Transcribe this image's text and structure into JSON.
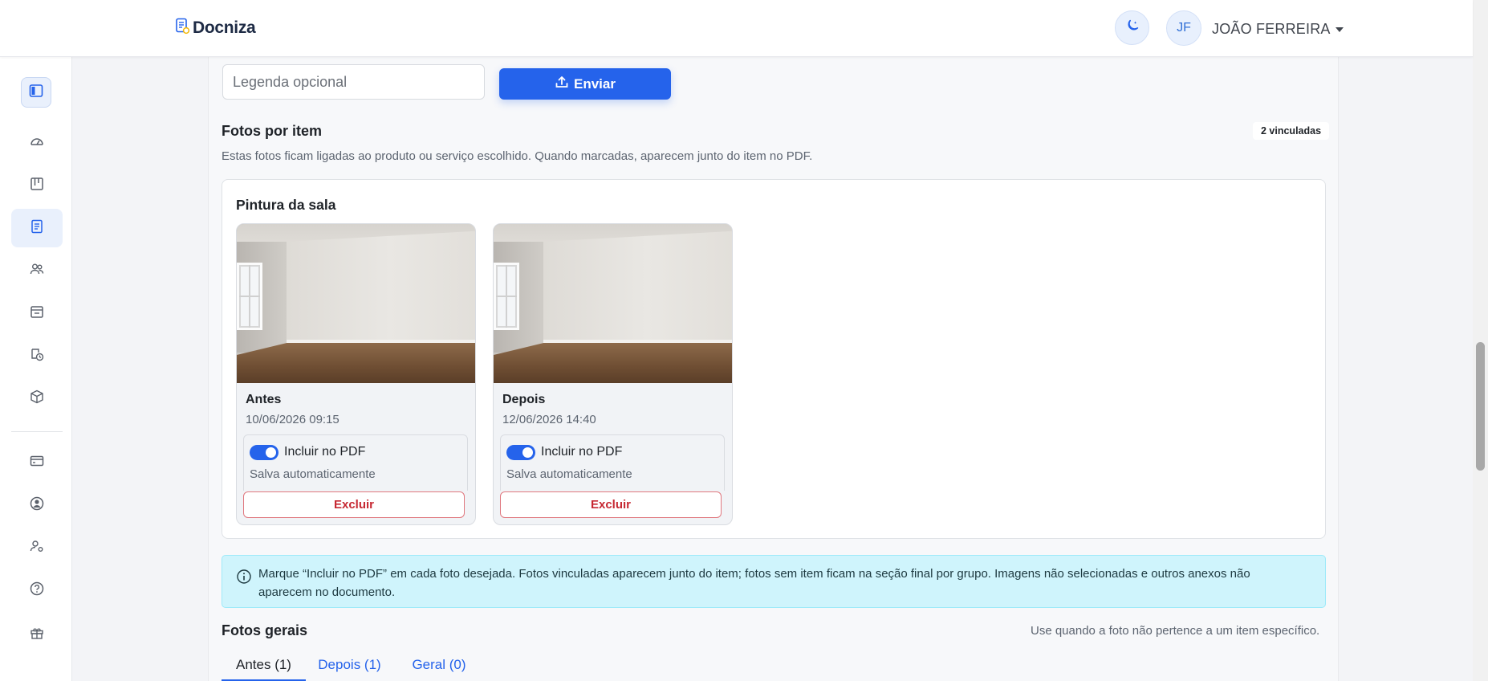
{
  "header": {
    "app_name": "Docniza",
    "user_initials": "JF",
    "user_name": "JOÃO FERREIRA"
  },
  "sidebar": {
    "items": [
      {
        "icon": "gauge-icon"
      },
      {
        "icon": "kanban-icon"
      },
      {
        "icon": "document-icon",
        "active": true
      },
      {
        "icon": "users-icon"
      },
      {
        "icon": "calendar-icon"
      },
      {
        "icon": "clock-refresh-icon"
      },
      {
        "icon": "box-icon"
      },
      {
        "icon": "credit-card-icon"
      },
      {
        "icon": "user-circle-icon"
      },
      {
        "icon": "user-gear-icon"
      },
      {
        "icon": "help-icon"
      },
      {
        "icon": "gift-icon"
      }
    ]
  },
  "upload": {
    "caption_placeholder": "Legenda opcional",
    "send_label": "Enviar"
  },
  "item_photos": {
    "title": "Fotos por item",
    "badge": "2 vinculadas",
    "description": "Estas fotos ficam ligadas ao produto ou serviço escolhido. Quando marcadas, aparecem junto do item no PDF.",
    "item_name": "Pintura da sala",
    "photos": [
      {
        "label": "Antes",
        "date": "10/06/2026 09:15",
        "include_label": "Incluir no PDF",
        "include_on": true,
        "saved_text": "Salva automaticamente",
        "delete_label": "Excluir"
      },
      {
        "label": "Depois",
        "date": "12/06/2026 14:40",
        "include_label": "Incluir no PDF",
        "include_on": true,
        "saved_text": "Salva automaticamente",
        "delete_label": "Excluir"
      }
    ]
  },
  "info": {
    "text": "Marque “Incluir no PDF” em cada foto desejada. Fotos vinculadas aparecem junto do item; fotos sem item ficam na seção final por grupo. Imagens não selecionadas e outros anexos não aparecem no documento."
  },
  "general_photos": {
    "title": "Fotos gerais",
    "hint": "Use quando a foto não pertence a um item específico.",
    "tabs": [
      {
        "label": "Antes (1)",
        "active": true
      },
      {
        "label": "Depois (1)",
        "active": false
      },
      {
        "label": "Geral (0)",
        "active": false
      }
    ]
  },
  "colors": {
    "primary": "#2563eb",
    "danger": "#c62832",
    "info_bg": "#cff4fc"
  }
}
